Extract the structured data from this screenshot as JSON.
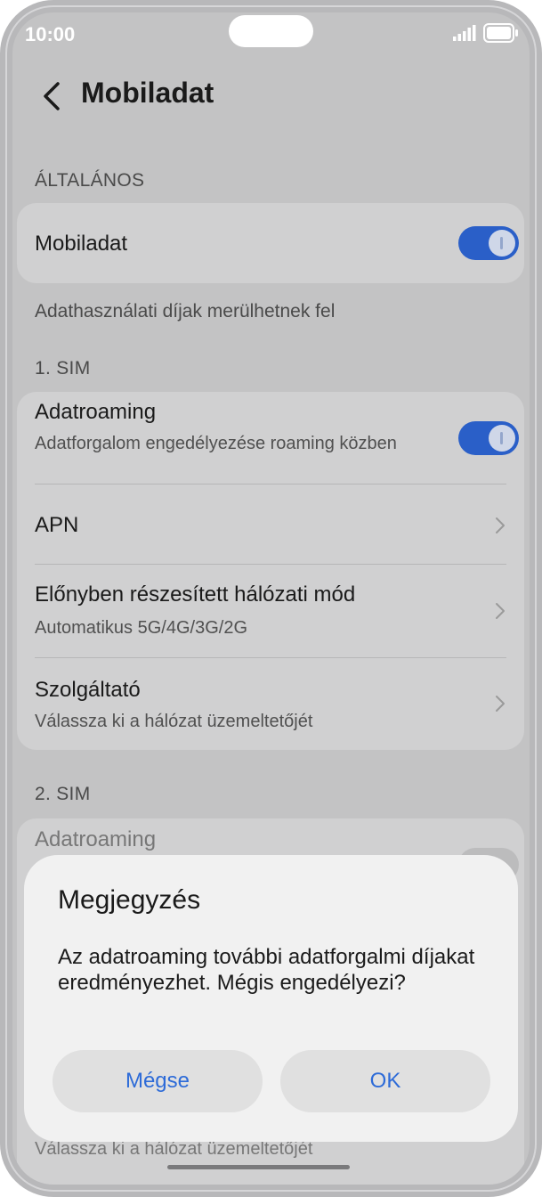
{
  "status_bar": {
    "time": "10:00"
  },
  "header": {
    "title": "Mobiladat"
  },
  "general": {
    "section_label": "ÁLTALÁNOS",
    "mobile_data_label": "Mobiladat",
    "mobile_data_on": true,
    "hint": "Adathasználati díjak merülhetnek fel"
  },
  "sim1": {
    "section_label": "1. SIM",
    "roaming_title": "Adatroaming",
    "roaming_subtitle": "Adatforgalom engedélyezése roaming közben",
    "apn_label": "APN",
    "network_mode_title": "Előnyben részesített hálózati mód",
    "network_mode_value": "Automatikus 5G/4G/3G/2G",
    "operator_title": "Szolgáltató",
    "operator_subtitle": "Válassza ki a hálózat üzemeltetőjét"
  },
  "sim2": {
    "section_label": "2. SIM",
    "roaming_title": "Adatroaming",
    "operator_subtitle": "Válassza ki a hálózat üzemeltetőjét"
  },
  "dialog": {
    "title": "Megjegyzés",
    "message": "Az adatroaming további adatforgalmi díjakat eredményezhet. Mégis engedélyezi?",
    "cancel_label": "Mégse",
    "ok_label": "OK"
  },
  "colors": {
    "accent": "#2d6bd8",
    "toggle_on": "#2a5fc8"
  }
}
